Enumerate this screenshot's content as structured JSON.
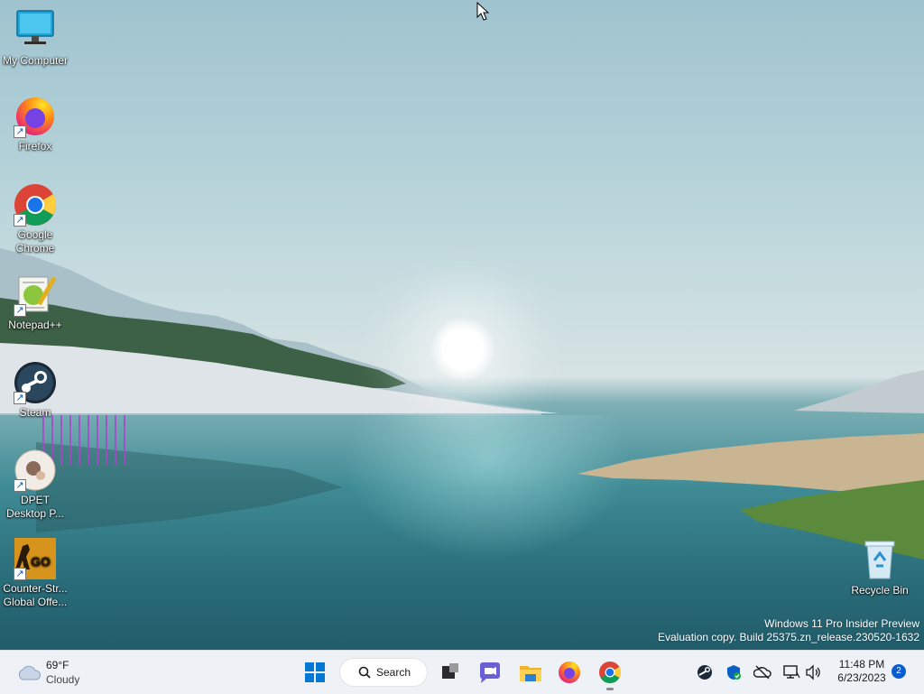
{
  "desktop": {
    "icons": [
      {
        "label": "My Computer",
        "icon": "monitor-icon"
      },
      {
        "label": "Firefox",
        "icon": "firefox-icon"
      },
      {
        "label": "Google Chrome",
        "icon": "chrome-icon"
      },
      {
        "label": "Notepad++",
        "icon": "notepadpp-icon"
      },
      {
        "label": "Steam",
        "icon": "steam-icon"
      },
      {
        "label": "DPET Desktop P...",
        "icon": "dpet-icon"
      },
      {
        "label": "Counter-Str... Global Offe...",
        "icon": "csgo-icon"
      },
      {
        "label": "Recycle Bin",
        "icon": "recycle-bin-icon"
      }
    ],
    "watermark": {
      "line1": "Windows 11 Pro Insider Preview",
      "line2": "Evaluation copy. Build 25375.zn_release.230520-1632"
    }
  },
  "taskbar": {
    "weather": {
      "temp": "69°F",
      "condition": "Cloudy",
      "icon": "cloudy-icon"
    },
    "start_icon": "windows-start-icon",
    "search_label": "Search",
    "pinned": [
      "task-view-icon",
      "teams-chat-icon",
      "file-explorer-icon",
      "firefox-icon",
      "chrome-icon"
    ],
    "tray": [
      "steam-tray-icon",
      "defender-icon",
      "onedrive-icon",
      "network-icon",
      "volume-icon"
    ],
    "time": "11:48 PM",
    "date": "6/23/2023",
    "notification_count": "2"
  },
  "colors": {
    "taskbar_bg": "#eef1f6",
    "accent": "#0b5cce"
  }
}
